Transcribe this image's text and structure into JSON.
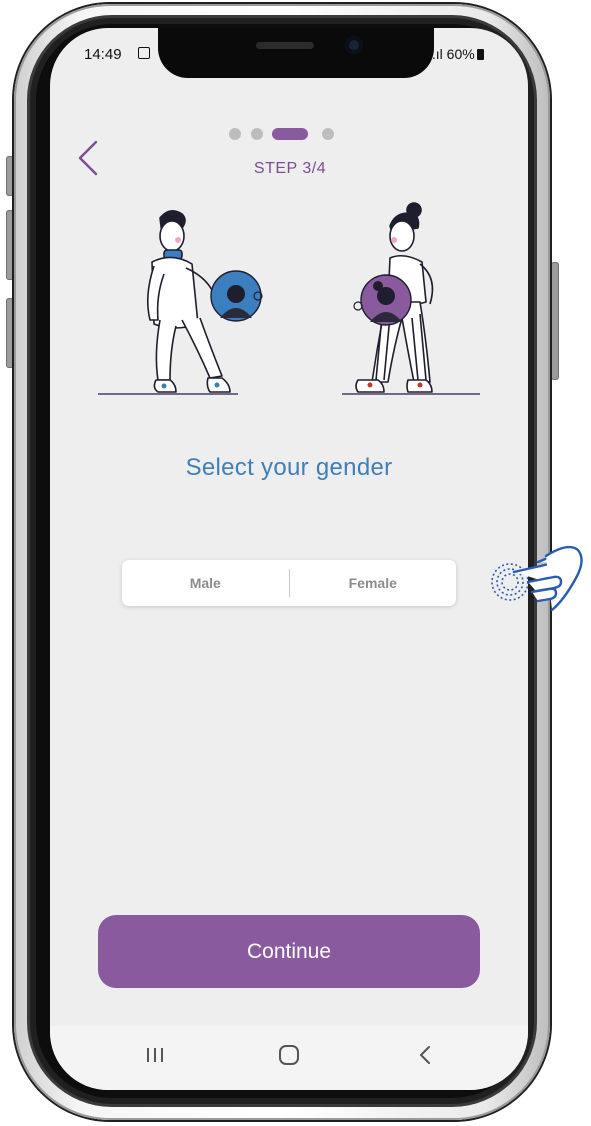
{
  "status_bar": {
    "time": "14:49",
    "signal_battery": " .ıl 60%"
  },
  "header": {
    "back_icon": "chevron-left-icon",
    "step_label": "STEP 3/4",
    "progress": {
      "current": 3,
      "total": 4
    }
  },
  "illustration": {
    "left_figure": "man-holding-avatar",
    "right_figure": "woman-holding-avatar"
  },
  "main": {
    "title": "Select your gender",
    "gender_options": [
      {
        "label": "Male"
      },
      {
        "label": "Female"
      }
    ]
  },
  "footer": {
    "continue_label": "Continue"
  },
  "system_nav": {
    "recents_icon": "recents-icon",
    "home_icon": "home-icon",
    "back_icon": "nav-back-icon"
  },
  "colors": {
    "accent_purple": "#8a5a9f",
    "title_blue": "#3f7fb6",
    "screen_background": "#eeeeee",
    "hand_hint_blue": "#2a5db0"
  }
}
